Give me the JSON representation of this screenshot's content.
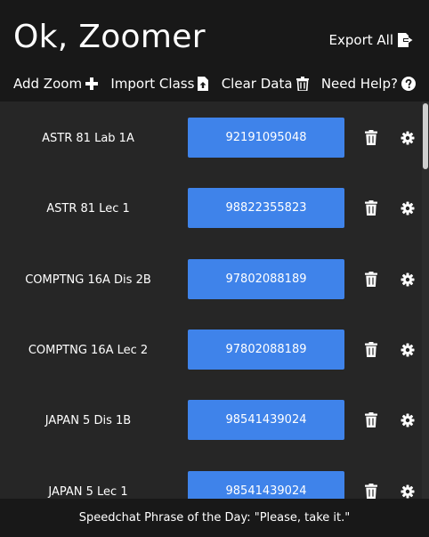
{
  "app": {
    "title": "Ok, Zoomer"
  },
  "header": {
    "export_label": "Export All",
    "export_icon": "export-icon",
    "toolbar": [
      {
        "label": "Add Zoom",
        "icon": "plus-icon"
      },
      {
        "label": "Import Class",
        "icon": "file-upload-icon"
      },
      {
        "label": "Clear Data",
        "icon": "trash-outline-icon"
      },
      {
        "label": "Need Help?",
        "icon": "question-circle-icon"
      }
    ]
  },
  "classes": [
    {
      "name": "ASTR 81 Lab 1A",
      "meeting_id": "92191095048"
    },
    {
      "name": "ASTR 81 Lec 1",
      "meeting_id": "98822355823"
    },
    {
      "name": "COMPTNG 16A Dis 2B",
      "meeting_id": "97802088189"
    },
    {
      "name": "COMPTNG 16A Lec 2",
      "meeting_id": "97802088189"
    },
    {
      "name": "JAPAN 5 Dis 1B",
      "meeting_id": "98541439024"
    },
    {
      "name": "JAPAN 5 Lec 1",
      "meeting_id": "98541439024"
    }
  ],
  "footer": {
    "text": "Speedchat Phrase of the Day: \"Please, take it.\""
  },
  "colors": {
    "accent": "#3f83ea",
    "header_bg": "#181818",
    "body_bg": "#262626"
  }
}
